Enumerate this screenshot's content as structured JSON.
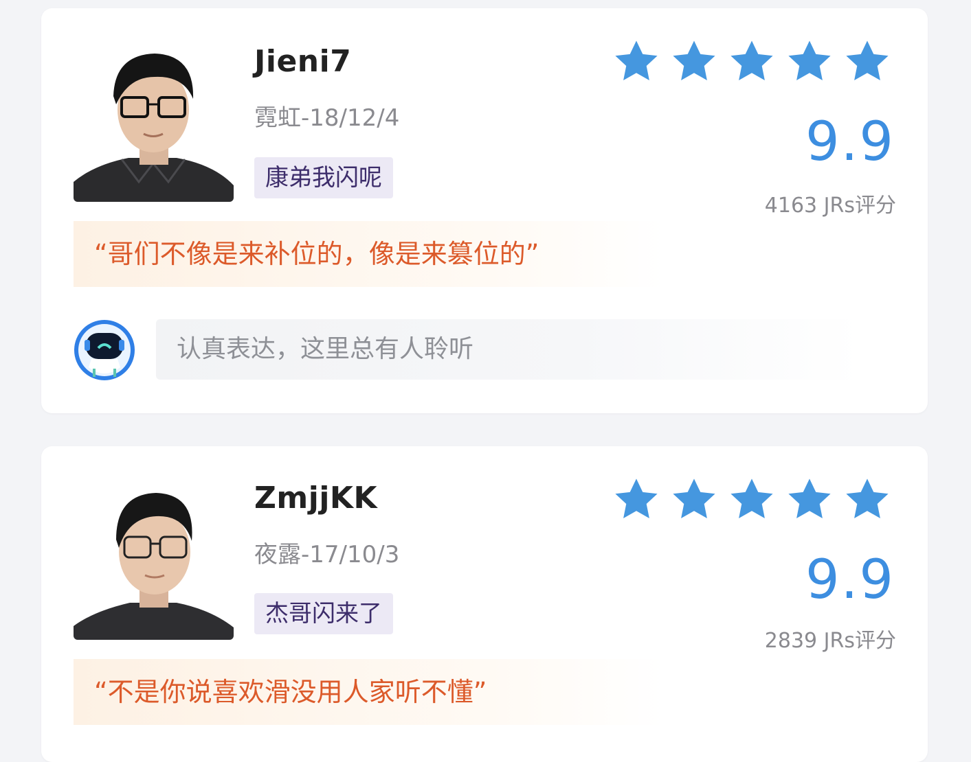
{
  "reviews": [
    {
      "name": "Jieni7",
      "meta": "霓虹-18/12/4",
      "tag": "康弟我闪呢",
      "stars": 5,
      "score": "9.9",
      "votes": "4163 JRs评分",
      "quote": "“哥们不像是来补位的，像是来篡位的”",
      "comment_placeholder": "认真表达，这里总有人聆听"
    },
    {
      "name": "ZmjjKK",
      "meta": "夜露-17/10/3",
      "tag": "杰哥闪来了",
      "stars": 5,
      "score": "9.9",
      "votes": "2839 JRs评分",
      "quote": "“不是你说喜欢滑没用人家听不懂”"
    }
  ],
  "colors": {
    "star": "#4597df",
    "score": "#3d8ee0",
    "quote_text": "#dc5a2a",
    "tag_bg": "#ece9f5"
  },
  "icons": {
    "star": "star-icon",
    "bot_avatar": "robot-avatar-icon"
  }
}
